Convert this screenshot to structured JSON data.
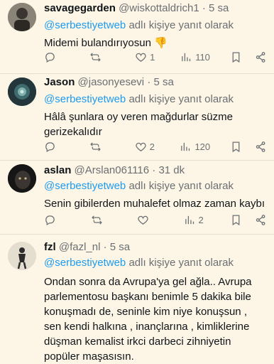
{
  "tweets": [
    {
      "name": "savagegarden",
      "handle": "@wiskottaldrich1",
      "time": "· 5 sa",
      "reply_to": "@serbestiyetweb",
      "reply_suffix": "adlı kişiye yanıt olarak",
      "text": "Midemi bulandırıyosun 👎",
      "replies": "",
      "retweets": "",
      "likes": "1",
      "views": "110"
    },
    {
      "name": "Jason",
      "handle": "@jasonyesevi",
      "time": "· 5 sa",
      "reply_to": "@serbestiyetweb",
      "reply_suffix": "adlı kişiye yanıt olarak",
      "text": "Hâlâ şunlara oy veren mağdurlar süzme gerizekalıdır",
      "replies": "",
      "retweets": "",
      "likes": "2",
      "views": "120"
    },
    {
      "name": "aslan",
      "handle": "@Arslan061116",
      "time": "· 31 dk",
      "reply_to": "@serbestiyetweb",
      "reply_suffix": "adlı kişiye yanıt olarak",
      "text": "Senin gibilerden muhalefet olmaz zaman kaybı",
      "replies": "",
      "retweets": "",
      "likes": "",
      "views": "2"
    },
    {
      "name": "fzl",
      "handle": "@fazl_nl",
      "time": "· 5 sa",
      "reply_to": "@serbestiyetweb",
      "reply_suffix": "adlı kişiye yanıt olarak",
      "text": "Ondan sonra da Avrupa'ya gel ağla.. Avrupa parlementosu başkanı benimle 5 dakika bile konuşmadı de, seninle kim niye konuşsun , sen kendi halkına , inançlarına , kimliklerine düşman kemalist irkci darbeci zihniyetin popüler maşasısın."
    }
  ]
}
